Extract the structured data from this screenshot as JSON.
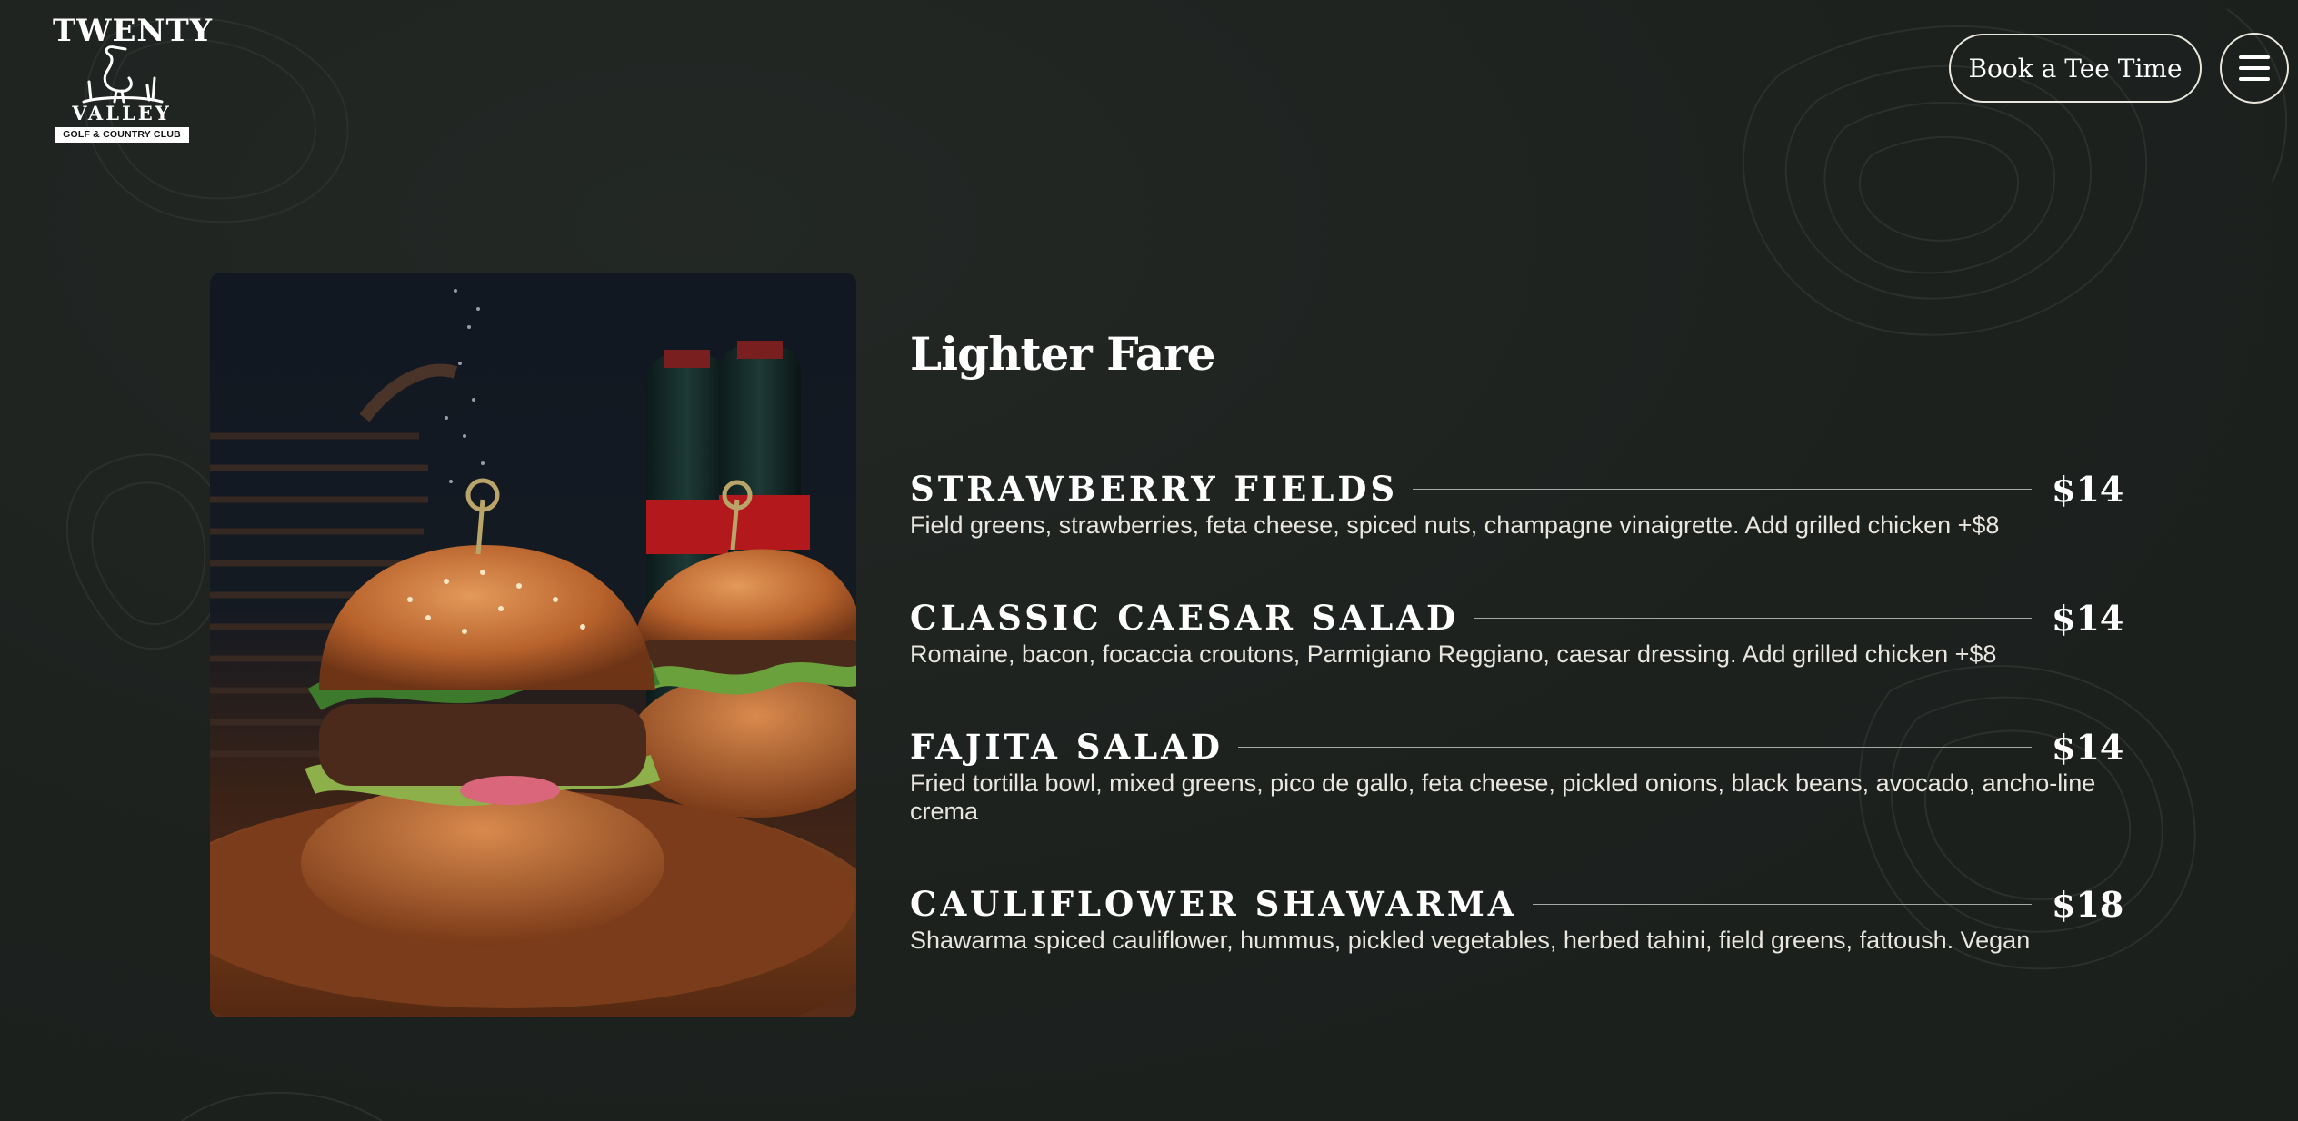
{
  "brand": {
    "line1": "TWENTY",
    "line2": "VALLEY",
    "line3": "GOLF & COUNTRY CLUB"
  },
  "header": {
    "book_label": "Book a Tee Time",
    "menu_icon": "hamburger-menu-icon"
  },
  "photo": {
    "subject": "burgers with cola bottles on wooden board"
  },
  "section": {
    "title": "Lighter Fare"
  },
  "items": [
    {
      "name": "STRAWBERRY FIELDS",
      "price": "$14",
      "description": "Field greens, strawberries, feta cheese, spiced nuts, champagne vinaigrette. Add grilled chicken +$8"
    },
    {
      "name": "CLASSIC CAESAR SALAD",
      "price": "$14",
      "description": "Romaine, bacon, focaccia croutons, Parmigiano Reggiano, caesar dressing. Add grilled chicken +$8"
    },
    {
      "name": "FAJITA SALAD",
      "price": "$14",
      "description": "Fried tortilla bowl, mixed greens, pico de gallo, feta cheese, pickled onions, black beans, avocado, ancho-line crema"
    },
    {
      "name": "CAULIFLOWER SHAWARMA",
      "price": "$18",
      "description": "Shawarma spiced cauliflower, hummus, pickled vegetables, herbed tahini, field greens, fattoush. Vegan"
    }
  ],
  "colors": {
    "background": "#1e221f",
    "text": "#f3f1ea",
    "rule": "#a7aaa4"
  }
}
